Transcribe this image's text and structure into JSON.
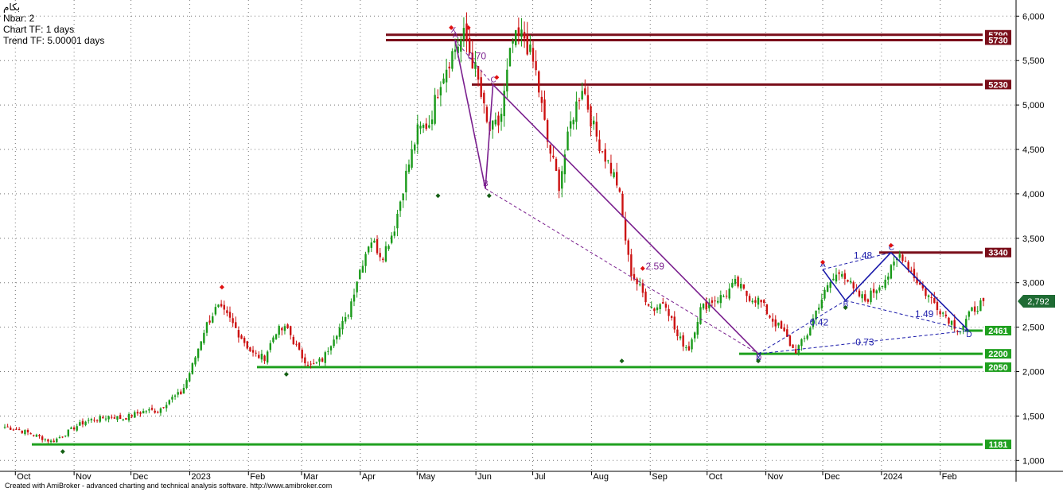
{
  "header": {
    "symbol": "بکام",
    "nbar": "Nbar: 2",
    "chart_tf": "Chart TF: 1 days",
    "trend_tf": "Trend TF: 5.00001 days"
  },
  "footer": "Created with AmiBroker - advanced charting and technical analysis software. http://www.amibroker.com",
  "chart_data": {
    "type": "candlestick",
    "title": "",
    "xlabel": "",
    "ylabel": "",
    "ylim": [
      1000,
      6100
    ],
    "y_ticks": [
      1000,
      1500,
      2000,
      2500,
      3000,
      3500,
      4000,
      4500,
      5000,
      5500,
      6000
    ],
    "y_tick_labels": [
      "1,000",
      "1,500",
      "2,000",
      "2,500",
      "3,000",
      "3,500",
      "4,000",
      "4,500",
      "5,000",
      "5,500",
      "6,000"
    ],
    "x_tick_labels": [
      "Oct",
      "Nov",
      "Dec",
      "2023",
      "Feb",
      "Mar",
      "Apr",
      "May",
      "Jun",
      "Jul",
      "Aug",
      "Sep",
      "Oct",
      "Nov",
      "Dec",
      "2024",
      "Feb"
    ],
    "last_price": 2792,
    "last_price_label": "2,792",
    "grid": true,
    "colors": {
      "up": "#1a9a1a",
      "down": "#cc1111",
      "resistance": "#7a0e1a",
      "support": "#1fa01f",
      "pattern_purple": "#7a1f8e",
      "pattern_blue": "#1a1aaa",
      "swing_high": "#e01010",
      "swing_low": "#156015",
      "last_price_bg": "#1f6b34"
    },
    "path_points": [
      1380,
      1350,
      1310,
      1260,
      1210,
      1290,
      1380,
      1450,
      1470,
      1500,
      1470,
      1520,
      1560,
      1560,
      1690,
      1760,
      2100,
      2500,
      2730,
      2600,
      2400,
      2200,
      2150,
      2460,
      2480,
      2200,
      2060,
      2140,
      2420,
      2600,
      3100,
      3500,
      3300,
      3600,
      4200,
      4700,
      4800,
      5300,
      5600,
      5790,
      5350,
      4700,
      4800,
      5700,
      5790,
      5400,
      4600,
      4100,
      4800,
      5230,
      4700,
      4400,
      4100,
      3150,
      2900,
      2700,
      2800,
      2400,
      2250,
      2700,
      2800,
      2850,
      3000,
      2850,
      2800,
      2600,
      2450,
      2220,
      2400,
      2750,
      3000,
      3150,
      2900,
      2800,
      2950,
      3100,
      3340,
      3100,
      2900,
      2750,
      2600,
      2461,
      2680,
      2792
    ],
    "resistance_levels": [
      {
        "value": 5790,
        "label": "5790"
      },
      {
        "value": 5730,
        "label": "5730"
      },
      {
        "value": 5230,
        "label": "5230"
      },
      {
        "value": 3340,
        "label": "3340"
      }
    ],
    "support_levels": [
      {
        "value": 2461,
        "label": "2461"
      },
      {
        "value": 2200,
        "label": "2200"
      },
      {
        "value": 2050,
        "label": "2050"
      },
      {
        "value": 1181,
        "label": "1181"
      }
    ],
    "harmonic_patterns": [
      {
        "points": [
          {
            "label": "X",
            "date": "2023-05-20",
            "value": 5790
          },
          {
            "label": "A",
            "date": "2023-05-21",
            "value": 5730
          },
          {
            "label": "B",
            "date": "2023-06-06",
            "value": 4060
          },
          {
            "label": "C",
            "date": "2023-06-10",
            "value": 5230
          },
          {
            "label": "D",
            "date": "2023-10-28",
            "value": 2200
          }
        ],
        "ratios": [
          "0.70",
          "2.59"
        ]
      },
      {
        "points": [
          {
            "label": "X",
            "date": "2023-10-28",
            "value": 2200
          },
          {
            "label": "A",
            "date": "2023-12-01",
            "value": 3150
          },
          {
            "label": "B",
            "date": "2023-12-13",
            "value": 2800
          },
          {
            "label": "C",
            "date": "2024-01-06",
            "value": 3340
          },
          {
            "label": "D",
            "date": "2024-02-16",
            "value": 2461
          }
        ],
        "ratios": [
          "1.48",
          "0.42",
          "1.49",
          "0.73"
        ]
      }
    ]
  }
}
